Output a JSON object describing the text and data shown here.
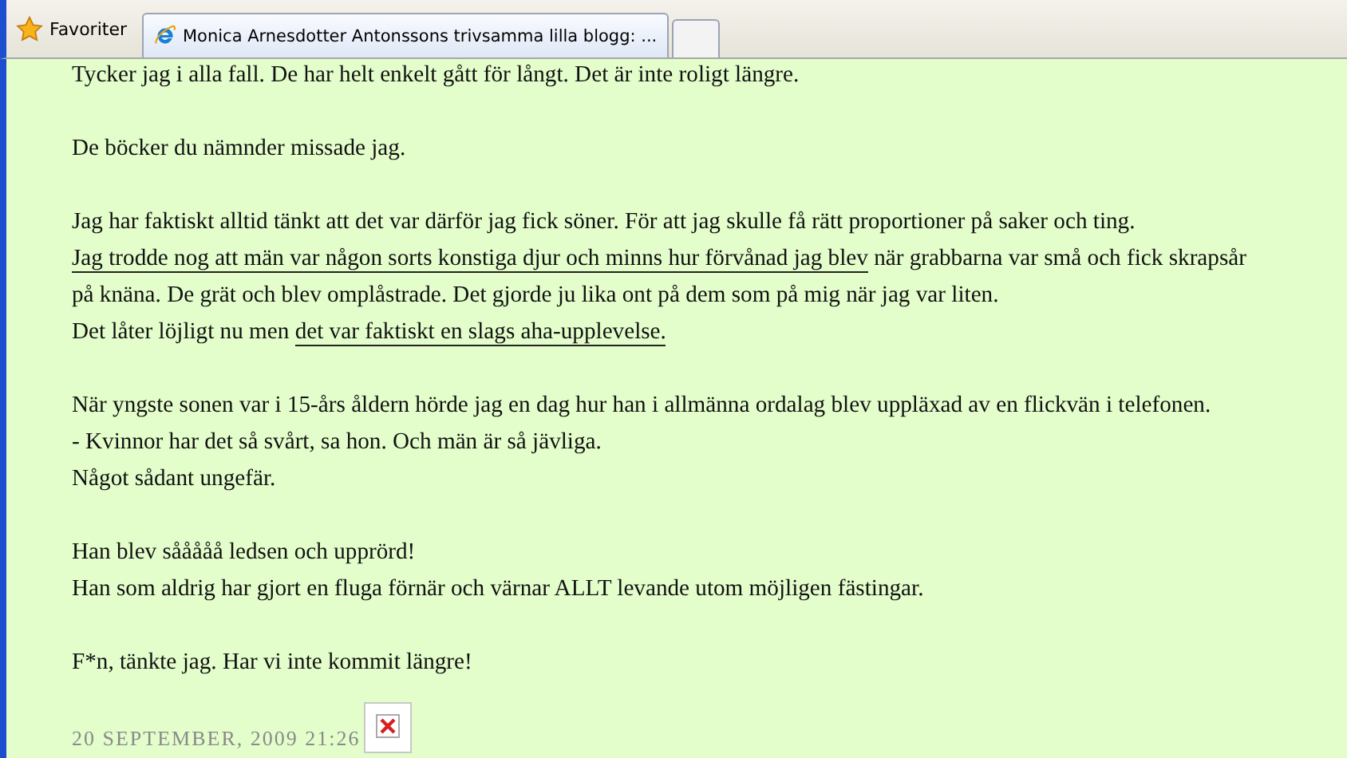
{
  "toolbar": {
    "favorites": "Favoriter",
    "tabs": [
      {
        "title": "Monica Arnesdotter Antonssons trivsamma lilla blogg: ...",
        "selected": true
      }
    ]
  },
  "post": {
    "paragraphs": [
      [
        [
          {
            "text": "Tycker jag i alla fall. De har helt enkelt gått för långt. Det är inte roligt längre.",
            "link": false
          }
        ]
      ],
      [
        [
          {
            "text": "De böcker du nämnder missade jag.",
            "link": false
          }
        ]
      ],
      [
        [
          {
            "text": "Jag har faktiskt alltid tänkt att det var därför jag fick söner. För att jag skulle få rätt proportioner på saker och ting.",
            "link": false
          }
        ],
        [
          {
            "text": "Jag trodde nog att män var någon sorts konstiga djur och minns hur förvånad jag blev",
            "link": true
          },
          {
            "text": " när grabbarna var små och fick skrapsår",
            "link": false
          }
        ],
        [
          {
            "text": "på knäna. De grät och blev omplåstrade. Det gjorde ju lika ont på dem som på mig när jag var liten.",
            "link": false
          }
        ],
        [
          {
            "text": "Det låter löjligt nu men ",
            "link": false
          },
          {
            "text": "det var faktiskt en slags aha-upplevelse.",
            "link": true
          }
        ]
      ],
      [
        [
          {
            "text": "När yngste sonen var i 15-års åldern hörde jag en dag hur han i allmänna ordalag blev uppläxad av en flickvän i telefonen.",
            "link": false
          }
        ],
        [
          {
            "text": "- Kvinnor har det så svårt, sa hon. Och män är så jävliga.",
            "link": false
          }
        ],
        [
          {
            "text": "Något sådant ungefär.",
            "link": false
          }
        ]
      ],
      [
        [
          {
            "text": "Han blev sååååå ledsen och upprörd!",
            "link": false
          }
        ],
        [
          {
            "text": "Han som aldrig har gjort en fluga förnär och värnar ALLT levande utom möjligen fästingar.",
            "link": false
          }
        ]
      ],
      [
        [
          {
            "text": "F*n, tänkte jag. Har vi inte kommit längre!",
            "link": false
          }
        ]
      ]
    ],
    "date": "20 SEPTEMBER, 2009 21:26"
  }
}
